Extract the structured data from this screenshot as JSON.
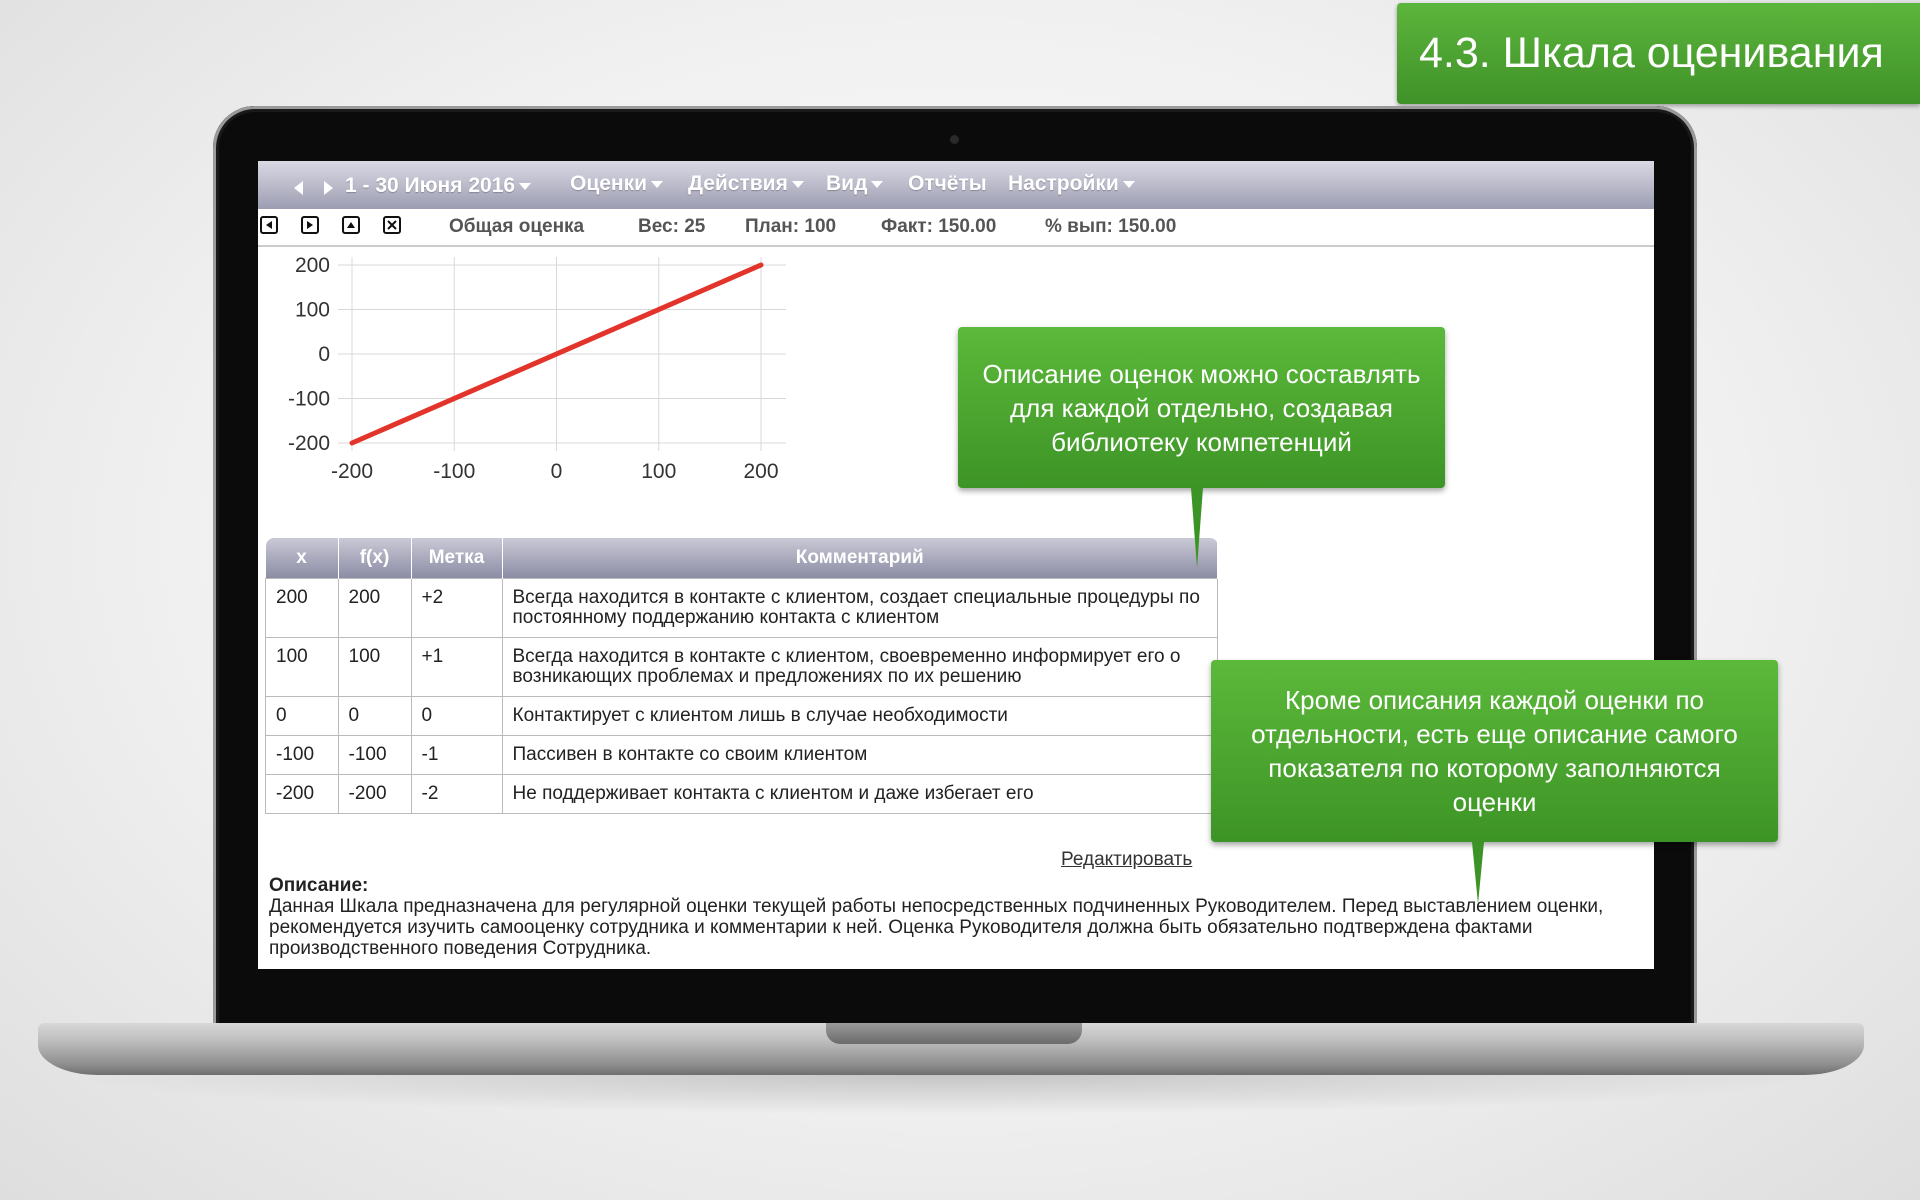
{
  "slide_title": "4.3. Шкала оценивания",
  "menu": {
    "period": "1 - 30 Июня 2016",
    "items": [
      {
        "label": "Оценки",
        "dropdown": true
      },
      {
        "label": "Действия",
        "dropdown": true
      },
      {
        "label": "Вид",
        "dropdown": true
      },
      {
        "label": "Отчёты",
        "dropdown": false
      },
      {
        "label": "Настройки",
        "dropdown": true
      }
    ]
  },
  "info": {
    "name": "Общая оценка",
    "weight": "Вес: 25",
    "plan": "План: 100",
    "fact": "Факт: 150.00",
    "percent": "% вып: 150.00"
  },
  "chart_data": {
    "type": "line",
    "x": [
      -200,
      200
    ],
    "series": [
      {
        "values": [
          -200,
          200
        ],
        "color": "#e3342b"
      }
    ],
    "xlim": [
      -200,
      200
    ],
    "ylim": [
      -200,
      200
    ],
    "xticks": [
      "-200",
      "-100",
      "0",
      "100",
      "200"
    ],
    "yticks": [
      "200",
      "100",
      "0",
      "-100",
      "-200"
    ],
    "grid": true
  },
  "table": {
    "headers": [
      "x",
      "f(x)",
      "Метка",
      "Комментарий"
    ],
    "rows": [
      [
        "200",
        "200",
        "+2",
        "Всегда находится в контакте с клиентом, создает специальные процедуры по постоянному поддержанию контакта с клиентом"
      ],
      [
        "100",
        "100",
        "+1",
        "Всегда находится в контакте с клиентом, своевременно информирует его о возникающих проблемах и предложениях по их решению"
      ],
      [
        "0",
        "0",
        "0",
        "Контактирует с клиентом лишь в случае необходимости"
      ],
      [
        "-100",
        "-100",
        "-1",
        "Пассивен в контакте со своим клиентом"
      ],
      [
        "-200",
        "-200",
        "-2",
        "Не поддерживает контакта с клиентом и даже избегает его"
      ]
    ]
  },
  "edit_label": "Редактировать",
  "description": {
    "label": "Описание:",
    "text": "Данная Шкала предназначена для регулярной оценки текущей работы непосредственных подчиненных Руководителем. Перед выставлением оценки, рекомендуется изучить самооценку сотрудника и комментарии к ней. Оценка Руководителя должна быть обязательно подтверждена фактами производственного поведения Сотрудника."
  },
  "callouts": {
    "top": "Описание оценок можно составлять для каждой отдельно, создавая библиотеку компетенций",
    "bottom": "Кроме описания каждой оценки по отдельности, есть еще описание самого показателя по которому заполняются оценки"
  },
  "colors": {
    "accent_green": "#4aa62f",
    "line_red": "#e3342b",
    "menubar": "#a6a6ba"
  }
}
